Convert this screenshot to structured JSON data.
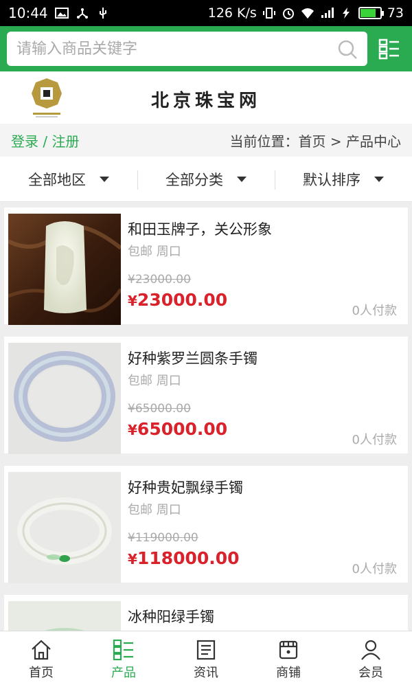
{
  "status": {
    "time": "10:44",
    "net_speed": "126 K/s",
    "battery": "73"
  },
  "search": {
    "placeholder": "请输入商品关键字"
  },
  "brand": {
    "name": "北京珠宝网"
  },
  "nav": {
    "login": "登录 / 注册",
    "location": "当前位置：首页 > 产品中心"
  },
  "filters": [
    "全部地区",
    "全部分类",
    "默认排序"
  ],
  "products": [
    {
      "title": "和田玉牌子，关公形象",
      "ship": "包邮 周口",
      "old_price": "¥23000.00",
      "price_symbol": "¥",
      "price": "23000.00",
      "sold": "0人付款"
    },
    {
      "title": "好种紫罗兰圆条手镯",
      "ship": "包邮 周口",
      "old_price": "¥65000.00",
      "price_symbol": "¥",
      "price": "65000.00",
      "sold": "0人付款"
    },
    {
      "title": "好种贵妃飘绿手镯",
      "ship": "包邮 周口",
      "old_price": "¥119000.00",
      "price_symbol": "¥",
      "price": "118000.00",
      "sold": "0人付款"
    },
    {
      "title": "冰种阳绿手镯",
      "ship": "",
      "old_price": "",
      "price_symbol": "",
      "price": "",
      "sold": ""
    }
  ],
  "tabs": [
    "首页",
    "产品",
    "资讯",
    "商铺",
    "会员"
  ],
  "colors": {
    "brand_green": "#2aab52",
    "price_red": "#d9222b"
  }
}
